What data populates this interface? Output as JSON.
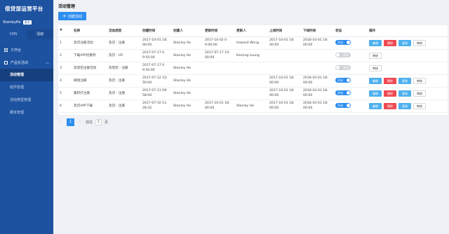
{
  "app": {
    "title": "借贷部运营平台"
  },
  "user": {
    "name": "StanleyHe",
    "badge": "退出"
  },
  "mode_tabs": [
    "CMS",
    "活动"
  ],
  "nav": {
    "workspace": "工作台",
    "product": "产品化活动",
    "sub_items": [
      "活动管理",
      "组件管理",
      "活动类型管理",
      "脚本管理"
    ]
  },
  "page": {
    "title": "活动管理",
    "create_label": "创建活动"
  },
  "table": {
    "headers": [
      "#",
      "名称",
      "活动类型",
      "创建时间",
      "创建人",
      "更新时间",
      "更新人",
      "上线时间",
      "下线时间",
      "状态",
      "操作"
    ],
    "rows": [
      {
        "id": "1",
        "name": "及贷注册活动",
        "type": "及贷 - 注册",
        "created": [
          "2017-10-01 18:",
          "00:00"
        ],
        "creator": "Stanley He",
        "updated": [
          "2017-10-02 0",
          "9:00:00"
        ],
        "updater": "Howard Wong",
        "online": [
          "2017-10-01 18:",
          "00:00"
        ],
        "offline": [
          "2018-10-01 18:",
          "00:00"
        ],
        "status": "开启",
        "status_on": true,
        "ops": [
          "编辑",
          "删除",
          "复制",
          "审核"
        ]
      },
      {
        "id": "2",
        "name": "下载APP优惠券",
        "type": "及贷 - H5",
        "created": [
          "2017-07-17 0",
          "9:50:00"
        ],
        "creator": "Stanley He",
        "updated": [
          "2017-07-17 10:",
          "00:00"
        ],
        "updater": "Kaming Leung",
        "online": [
          "",
          ""
        ],
        "offline": [
          "",
          ""
        ],
        "status": "关闭",
        "status_on": false,
        "ops": [
          "审核"
        ]
      },
      {
        "id": "3",
        "name": "及借花注册活动",
        "type": "及借花 - 注册",
        "created": [
          "2017-07-17 0",
          "9:50:00"
        ],
        "creator": "Stanley He",
        "updated": [
          "",
          ""
        ],
        "updater": "",
        "online": [
          "",
          ""
        ],
        "offline": [
          "",
          ""
        ],
        "status": "关闭",
        "status_on": false,
        "ops": [
          "审核"
        ]
      },
      {
        "id": "4",
        "name": "微钱注册",
        "type": "及贷 - 注册",
        "created": [
          "2017-07-12 10:",
          "50:00"
        ],
        "creator": "Stanley He",
        "updated": [
          "",
          ""
        ],
        "updater": "",
        "online": [
          "2017-10-01 18:",
          "00:00"
        ],
        "offline": [
          "2018-10-01 18:",
          "00:00"
        ],
        "status": "开启",
        "status_on": true,
        "ops": [
          "编辑",
          "删除",
          "复制",
          "审核"
        ]
      },
      {
        "id": "5",
        "name": "集积打注册",
        "type": "及贷 - 注册",
        "created": [
          "2017-07-11 09:",
          "58:00"
        ],
        "creator": "Stanley He",
        "updated": [
          "",
          ""
        ],
        "updater": "",
        "online": [
          "2017-10-01 18:",
          "00:00"
        ],
        "offline": [
          "2018-10-01 18:",
          "00:00"
        ],
        "status": "开启",
        "status_on": true,
        "ops": [
          "编辑",
          "删除",
          "复制",
          "审核"
        ]
      },
      {
        "id": "6",
        "name": "及贷APP下载",
        "type": "及贷 - 注册",
        "created": [
          "2017-07-10 11:",
          "28:32"
        ],
        "creator": "Stanley He",
        "updated": [
          "2017-10-01 18:",
          "00:00"
        ],
        "updater": "Stanley He",
        "online": [
          "2017-10-01 18:",
          "00:00"
        ],
        "offline": [
          "2018-10-01 18:",
          "00:00"
        ],
        "status": "开启",
        "status_on": true,
        "ops": [
          "编辑",
          "删除",
          "复制",
          "审核"
        ]
      }
    ]
  },
  "pager": {
    "current": "1",
    "goto_label": "前往",
    "goto_value": "1",
    "page_unit": "页",
    "prev_icon": "chevron-left-icon",
    "next_icon": "chevron-right-icon"
  },
  "colors": {
    "sidebar": "#1d52a0",
    "accent": "#2e8ef0",
    "danger": "#ef4a54",
    "op_blue": "#4fb0ee"
  }
}
